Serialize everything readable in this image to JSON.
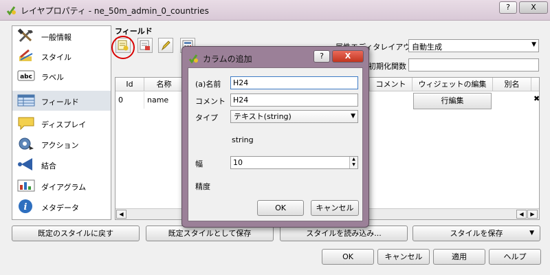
{
  "window": {
    "title": "レイヤプロパティ - ne_50m_admin_0_countries",
    "help_label": "?",
    "close_label": "X"
  },
  "sidebar": {
    "items": [
      {
        "label": "一般情報",
        "icon": "wrench-hammer-icon"
      },
      {
        "label": "スタイル",
        "icon": "paintbrush-icon"
      },
      {
        "label": "ラベル",
        "icon": "abc-label-icon"
      },
      {
        "label": "フィールド",
        "icon": "table-fields-icon",
        "selected": true
      },
      {
        "label": "ディスプレイ",
        "icon": "speech-bubble-icon"
      },
      {
        "label": "アクション",
        "icon": "gear-action-icon"
      },
      {
        "label": "結合",
        "icon": "join-arrow-icon"
      },
      {
        "label": "ダイアグラム",
        "icon": "diagram-chart-icon"
      },
      {
        "label": "メタデータ",
        "icon": "info-icon"
      }
    ]
  },
  "fields": {
    "title": "フィールド",
    "edit_layout_label": "属性エディタレイアウト",
    "edit_layout_value": "自動生成",
    "init_func_label": "初期化関数",
    "columns": [
      "Id",
      "名称",
      "コメント",
      "ウィジェットの編集",
      "別名"
    ],
    "rows": [
      {
        "id": "0",
        "name": "name",
        "edit_button": "行編集"
      }
    ]
  },
  "bottom_buttons": {
    "restore_default": "既定のスタイルに戻す",
    "save_default": "既定スタイルとして保存",
    "load_style": "スタイルを読み込み...",
    "save_style": "スタイルを保存",
    "ok": "OK",
    "cancel": "キャンセル",
    "apply": "適用",
    "help": "ヘルプ"
  },
  "dialog": {
    "title": "カラムの追加",
    "help_label": "?",
    "close_label": "X",
    "name_label": "(a)名前",
    "name_value": "H24",
    "comment_label": "コメント",
    "comment_value": "H24",
    "type_label": "タイプ",
    "type_value": "テキスト(string)",
    "type_name": "string",
    "width_label": "幅",
    "width_value": "10",
    "precision_label": "精度",
    "ok": "OK",
    "cancel": "キャンセル"
  },
  "colors": {
    "dialog_frame": "#9b8098",
    "highlight_circle": "#d90000",
    "selected_row": "#dfe4ea"
  }
}
